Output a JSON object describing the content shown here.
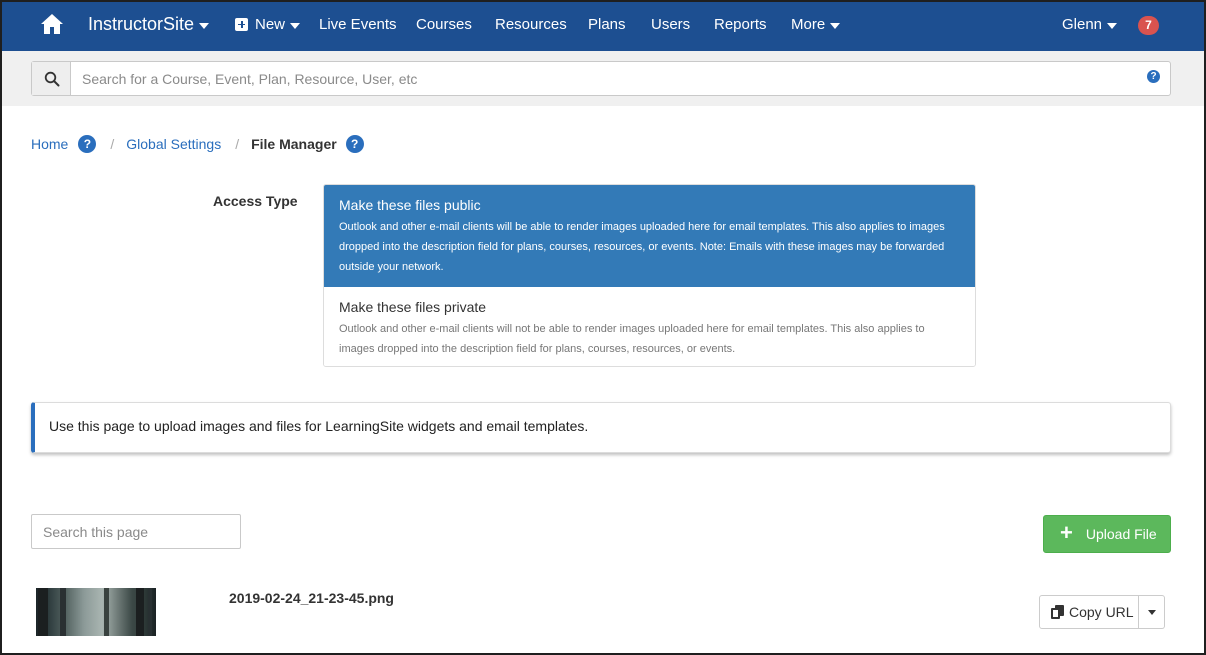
{
  "nav": {
    "home_icon": "home-icon",
    "brand": "InstructorSite",
    "new_label": "New",
    "items": [
      "Live Events",
      "Courses",
      "Resources",
      "Plans",
      "Users",
      "Reports"
    ],
    "more_label": "More",
    "user_label": "Glenn",
    "notification_count": "7",
    "bg_color": "#1d4f91"
  },
  "search": {
    "placeholder": "Search for a Course, Event, Plan, Resource, User, etc",
    "help": "?"
  },
  "breadcrumb": {
    "home": "Home",
    "home_help": "?",
    "separator": "/",
    "global_settings": "Global Settings",
    "current": "File Manager",
    "current_help": "?"
  },
  "access": {
    "label": "Access Type",
    "options": [
      {
        "title": "Make these files public",
        "description": "Outlook and other e-mail clients will be able to render images uploaded here for email templates. This also applies to images dropped into the description field for plans, courses, resources, or events. Note: Emails with these images may be forwarded outside your network.",
        "selected": true
      },
      {
        "title": "Make these files private",
        "description": "Outlook and other e-mail clients will not be able to render images uploaded here for email templates. This also applies to images dropped into the description field for plans, courses, resources, or events.",
        "selected": false
      }
    ],
    "selected_color": "#337ab7"
  },
  "alert": {
    "text": "Use this page to upload images and files for LearningSite widgets and email templates."
  },
  "page_search": {
    "placeholder": "Search this page"
  },
  "upload": {
    "label": "Upload File",
    "color": "#5cb85c"
  },
  "files": [
    {
      "name": "2019-02-24_21-23-45.png",
      "copy_label": "Copy URL"
    }
  ]
}
